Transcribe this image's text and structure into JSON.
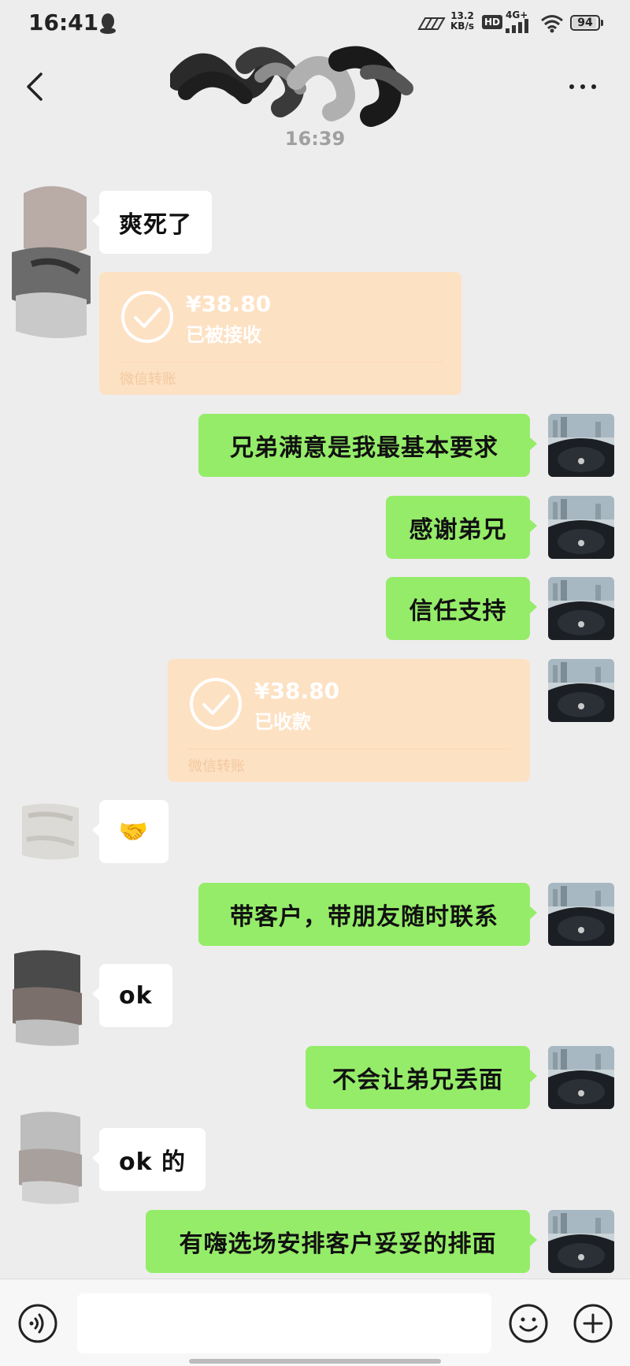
{
  "status_bar": {
    "time": "16:41",
    "net_speed_value": "13.2",
    "net_speed_unit": "KB/s",
    "hd_label": "HD",
    "network_label": "4G+",
    "battery": "94",
    "icons": [
      "qq-icon",
      "speed-icon",
      "signal-icon",
      "wifi-icon",
      "battery-icon"
    ]
  },
  "header": {
    "timestamp": "16:39",
    "icons": [
      "back-icon",
      "more-icon"
    ]
  },
  "messages": [
    {
      "side": "in",
      "type": "text",
      "text": "爽死了"
    },
    {
      "side": "in",
      "type": "transfer",
      "amount": "¥38.80",
      "status": "已被接收",
      "footer": "微信转账"
    },
    {
      "side": "out",
      "type": "text",
      "text": "兄弟满意是我最基本要求"
    },
    {
      "side": "out",
      "type": "text",
      "text": "感谢弟兄"
    },
    {
      "side": "out",
      "type": "text",
      "text": "信任支持"
    },
    {
      "side": "out",
      "type": "transfer",
      "amount": "¥38.80",
      "status": "已收款",
      "footer": "微信转账"
    },
    {
      "side": "in",
      "type": "emoji",
      "text": "🤝"
    },
    {
      "side": "out",
      "type": "text",
      "text": "带客户，带朋友随时联系"
    },
    {
      "side": "in",
      "type": "text",
      "text": "ok"
    },
    {
      "side": "out",
      "type": "text",
      "text": "不会让弟兄丢面"
    },
    {
      "side": "in",
      "type": "text",
      "text": "ok 的"
    },
    {
      "side": "out",
      "type": "text",
      "text": "有嗨选场安排客户妥妥的排面"
    }
  ],
  "input_bar": {
    "value": "",
    "icons": [
      "voice-icon",
      "emoji-icon",
      "plus-icon"
    ]
  },
  "colors": {
    "background": "#ededed",
    "incoming_bubble": "#ffffff",
    "outgoing_bubble": "#95ec69",
    "transfer_card": "#fde1c3"
  }
}
